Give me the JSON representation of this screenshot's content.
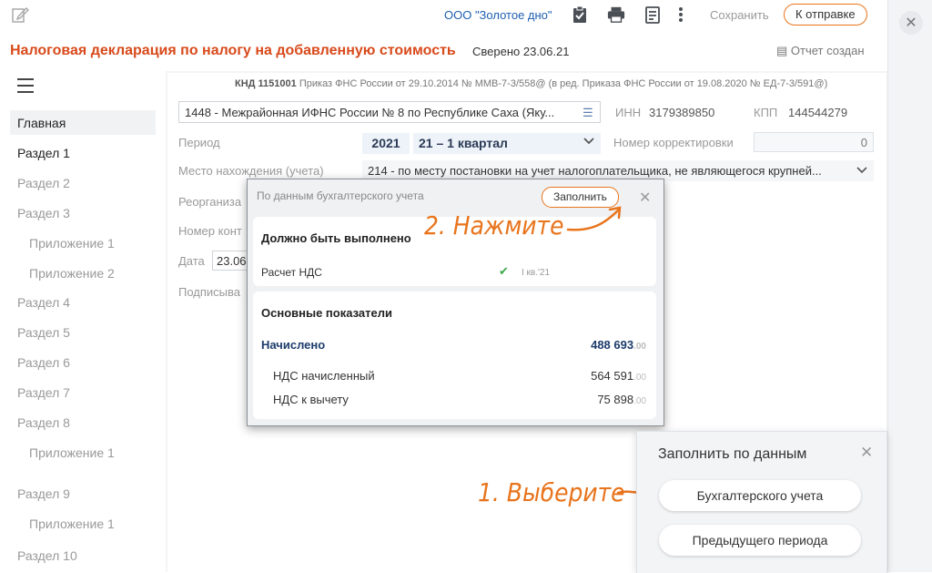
{
  "toolbar": {
    "org": "ООО \"Золотое дно\"",
    "save_label": "Сохранить",
    "send_label": "К отправке"
  },
  "header": {
    "title": "Налоговая декларация по налогу на добавленную стоимость",
    "verified": "Сверено 23.06.21",
    "report_status": "Отчет создан"
  },
  "sidebar": {
    "items": [
      {
        "label": "Главная"
      },
      {
        "label": "Раздел 1"
      },
      {
        "label": "Раздел 2"
      },
      {
        "label": "Раздел 3"
      },
      {
        "label": "Приложение 1"
      },
      {
        "label": "Приложение 2"
      },
      {
        "label": "Раздел 4"
      },
      {
        "label": "Раздел 5"
      },
      {
        "label": "Раздел 6"
      },
      {
        "label": "Раздел 7"
      },
      {
        "label": "Раздел 8"
      },
      {
        "label": "Приложение 1"
      },
      {
        "label": "Раздел 9"
      },
      {
        "label": "Приложение 1"
      },
      {
        "label": "Раздел 10"
      }
    ]
  },
  "form": {
    "knd_code": "КНД 1151001",
    "knd_text": "Приказ ФНС России от 29.10.2014 № ММВ-7-3/558@ (в ред. Приказа ФНС России от 19.08.2020 № ЕД-7-3/591@)",
    "inspection": "1448 - Межрайонная ИФНС России № 8 по Республике Саха (Яку...",
    "inn_label": "ИНН",
    "inn_value": "3179389850",
    "kpp_label": "КПП",
    "kpp_value": "144544279",
    "period_label": "Период",
    "year": "2021",
    "quarter": "21 – 1 квартал",
    "correction_label": "Номер корректировки",
    "correction_value": "0",
    "location_label": "Место нахождения (учета)",
    "location_value": "214 - по месту постановки на учет налогоплательщика, не являющегося крупней...",
    "reorg_label": "Реорганиза",
    "contact_label": "Номер конт",
    "date_label": "Дата",
    "date_value": "23.06",
    "signer_label": "Подписыва"
  },
  "popup": {
    "title": "По данным бухгалтерского учета",
    "fill_label": "Заполнить",
    "must_done_title": "Должно быть выполнено",
    "task_label": "Расчет НДС",
    "task_period": "I кв.'21",
    "indicators_title": "Основные показатели",
    "accrued_label": "Начислено",
    "accrued_value": "488 693",
    "accrued_cents": ".00",
    "vat_accrued_label": "НДС начисленный",
    "vat_accrued_value": "564 591",
    "vat_accrued_cents": ".00",
    "vat_deduct_label": "НДС к вычету",
    "vat_deduct_value": "75 898",
    "vat_deduct_cents": ".00"
  },
  "annotations": {
    "step2": "2. Нажмите",
    "step1": "1. Выберите"
  },
  "fill_panel": {
    "title": "Заполнить по данным",
    "option1": "Бухгалтерского учета",
    "option2": "Предыдущего периода"
  },
  "colors": {
    "accent": "#e8741c",
    "title": "#d84a1b",
    "link": "#1e5fb0"
  }
}
